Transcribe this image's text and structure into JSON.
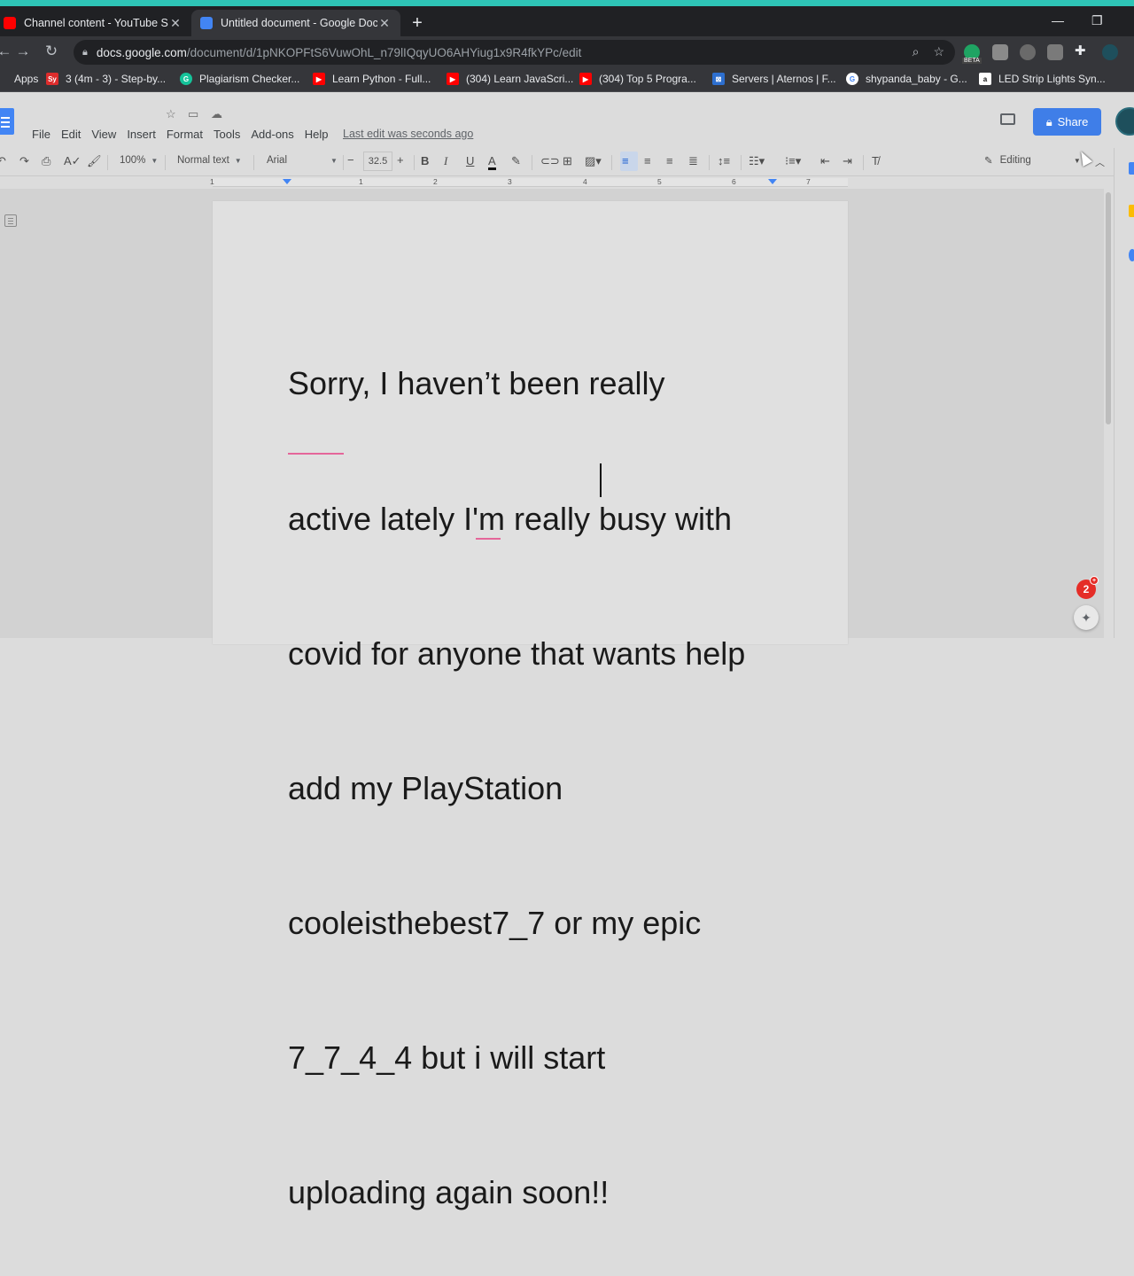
{
  "browser": {
    "tabs": [
      {
        "title": "Channel content - YouTube Studi",
        "favicon_color": "#ff0000",
        "active": false
      },
      {
        "title": "Untitled document - Google Doc",
        "favicon_color": "#4285f4",
        "active": true
      }
    ],
    "new_tab_label": "+",
    "address": {
      "domain": "docs.google.com",
      "path": "/document/d/1pNKOPFtS6VuwOhL_n79lIQqyUO6AHYiug1x9R4fkYPc/edit"
    },
    "beta_badge": "BETA",
    "bookmarks": [
      {
        "label": "Apps",
        "icon": "apps-grid-icon",
        "color": "#e8eaed"
      },
      {
        "label": "3 (4m - 3) - Step-by...",
        "icon": "symbolab-icon",
        "color": "#dd2c2c",
        "glyph": "Sy"
      },
      {
        "label": "Plagiarism Checker...",
        "icon": "grammarly-icon",
        "color": "#15c39a",
        "glyph": "G"
      },
      {
        "label": "Learn Python - Full...",
        "icon": "youtube-icon",
        "color": "#ff0000",
        "glyph": "▶"
      },
      {
        "label": "(304) Learn JavaScri...",
        "icon": "youtube-icon",
        "color": "#ff0000",
        "glyph": "▶"
      },
      {
        "label": "(304) Top 5 Progra...",
        "icon": "youtube-icon",
        "color": "#ff0000",
        "glyph": "▶"
      },
      {
        "label": "Servers | Aternos | F...",
        "icon": "aternos-icon",
        "color": "#2d6fcf",
        "glyph": "⊠"
      },
      {
        "label": "shypanda_baby - G...",
        "icon": "google-icon",
        "color": "#ffffff",
        "glyph": "G"
      },
      {
        "label": "LED Strip Lights Syn...",
        "icon": "amazon-icon",
        "color": "#ffffff",
        "glyph": "a"
      }
    ]
  },
  "docs": {
    "menu": [
      "File",
      "Edit",
      "View",
      "Insert",
      "Format",
      "Tools",
      "Add-ons",
      "Help"
    ],
    "last_edit": "Last edit was seconds ago",
    "share_label": "Share",
    "toolbar": {
      "zoom": "100%",
      "style": "Normal text",
      "font": "Arial",
      "font_size": "32.5",
      "mode": "Editing"
    },
    "ruler_numbers": [
      "1",
      "1",
      "2",
      "3",
      "4",
      "5",
      "6",
      "7"
    ],
    "body_lines": [
      "Sorry, I haven’t been really",
      "active lately I'm really busy with",
      "covid for anyone that wants help",
      "add my PlayStation",
      "cooleisthebest7_7 or my epic",
      "7_7_4_4 but i will start",
      "uploading again soon!!"
    ]
  },
  "notification_count": "2",
  "colors": {
    "accent": "#3f7ee8",
    "chrome_dark": "#202124",
    "spellcheck": "#e5669a"
  }
}
